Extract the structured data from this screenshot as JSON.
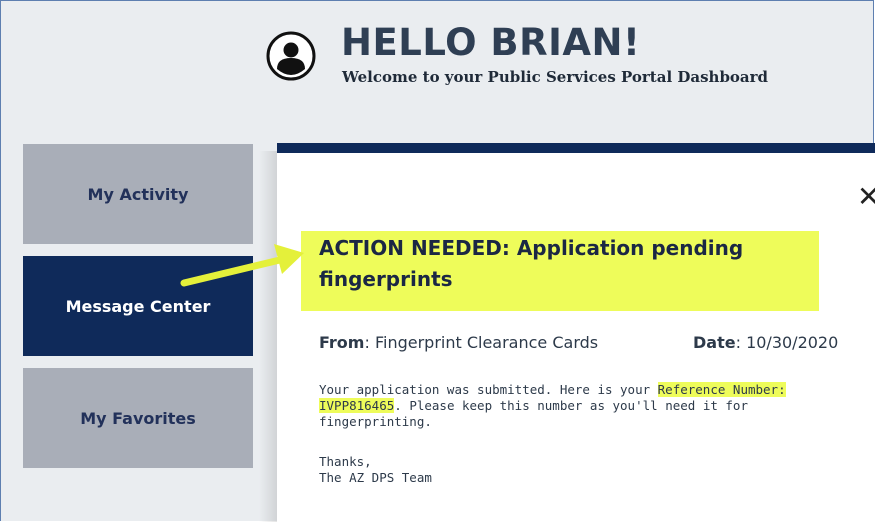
{
  "header": {
    "greeting": "HELLO BRIAN!",
    "subtitle": "Welcome to your Public Services Portal Dashboard",
    "avatar_icon": "user-circle-icon"
  },
  "nav": {
    "items": [
      {
        "label": "My Activity",
        "active": false
      },
      {
        "label": "Message Center",
        "active": true
      },
      {
        "label": "My Favorites",
        "active": false
      }
    ]
  },
  "message": {
    "close_label": "✕",
    "subject": "ACTION NEEDED: Application pending fingerprints",
    "from_label": "From",
    "from_value": "Fingerprint Clearance Cards",
    "date_label": "Date",
    "date_value": "10/30/2020",
    "body_part1": "Your application was submitted. Here is your ",
    "reference_label": "Reference Number:",
    "reference_number": "IVPP816465",
    "body_part2": ". Please keep this number as you'll need it for fingerprinting.",
    "signoff": "Thanks,",
    "team": "The AZ DPS Team"
  },
  "colors": {
    "highlight": "#eefc5a",
    "navy": "#0f2a5a",
    "nav_inactive": "#a9aeb8",
    "arrow": "#e4f03a"
  }
}
